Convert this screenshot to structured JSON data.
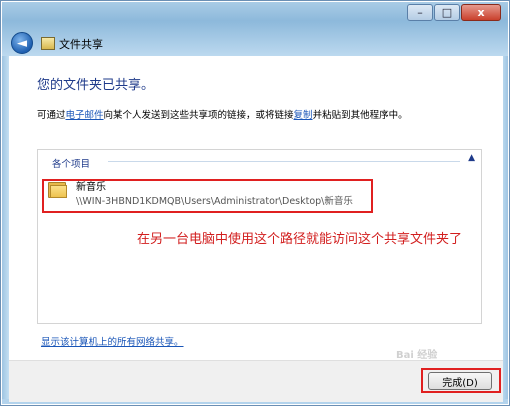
{
  "window": {
    "title": "文件共享",
    "controls": {
      "minimize": "–",
      "maximize": "□",
      "close": "x"
    },
    "back_glyph": "◄"
  },
  "main": {
    "heading": "您的文件夹已共享。",
    "desc_before": "可通过",
    "email_link": "电子邮件",
    "desc_middle": "向某个人发送到这些共享项的链接，或将链接",
    "copy_link": "复制",
    "desc_after": "并粘贴到其他程序中。"
  },
  "items_panel": {
    "header": "各个项目",
    "collapse_glyph": "▲",
    "items": [
      {
        "name": "新音乐",
        "path": "\\\\WIN-3HBND1KDMQB\\Users\\Administrator\\Desktop\\新音乐",
        "icon": "folder-icon"
      }
    ]
  },
  "annotation": "在另一台电脑中使用这个路径就能访问这个共享文件夹了",
  "footer": {
    "link": "显示该计算机上的所有网络共享。"
  },
  "buttons": {
    "finish": "完成(D)"
  },
  "watermark": "Bai 经验",
  "colors": {
    "accent_red": "#e02020",
    "link_blue": "#1a56b8",
    "heading_blue": "#1e3a8a"
  }
}
